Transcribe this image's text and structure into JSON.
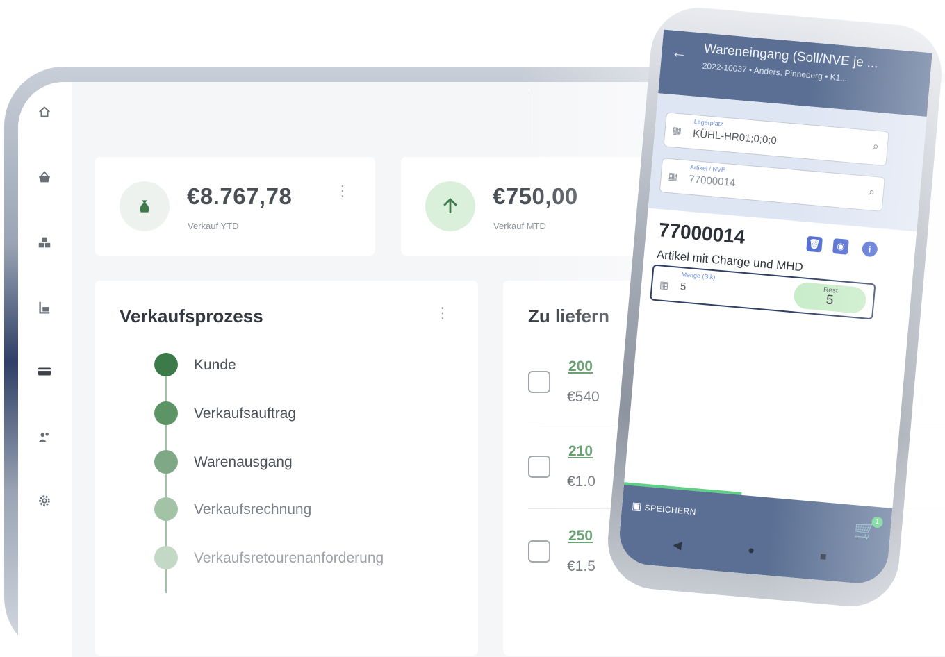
{
  "sidebar": {
    "items": [
      {
        "icon": "home-icon"
      },
      {
        "icon": "basket-icon"
      },
      {
        "icon": "boxes-icon"
      },
      {
        "icon": "forklift-icon"
      },
      {
        "icon": "card-icon"
      },
      {
        "icon": "people-icon"
      },
      {
        "icon": "gear-icon"
      }
    ]
  },
  "kpis": [
    {
      "value": "€8.767,78",
      "label": "Verkauf YTD",
      "icon": "money-bag-icon"
    },
    {
      "value": "€750,00",
      "label": "Verkauf MTD",
      "icon": "arrow-up-icon"
    }
  ],
  "process": {
    "title": "Verkaufsprozess",
    "steps": [
      {
        "label": "Kunde"
      },
      {
        "label": "Verkaufsauftrag"
      },
      {
        "label": "Warenausgang"
      },
      {
        "label": "Verkaufsrechnung"
      },
      {
        "label": "Verkaufsretourenanforderung"
      }
    ]
  },
  "deliveries": {
    "title": "Zu liefern",
    "rows": [
      {
        "order": "200",
        "amount": "€540"
      },
      {
        "order": "210",
        "amount": "€1.0"
      },
      {
        "order": "250",
        "amount": "€1.5"
      }
    ]
  },
  "phone": {
    "title": "Wareneingang (Soll/NVE je ...",
    "subtitle": "2022-10037 • Anders, Pinneberg • K1...",
    "lagerplatz_label": "Lagerplatz",
    "lagerplatz_value": "KÜHL-HR01;0;0;0",
    "artikel_label": "Artikel / NVE",
    "artikel_value": "77000014",
    "article_number": "77000014",
    "article_description": "Artikel mit Charge und MHD",
    "menge_label": "Menge (Stk)",
    "menge_value": "5",
    "rest_label": "Rest",
    "rest_value": "5",
    "save_label": "SPEICHERN",
    "cart_count": "1"
  },
  "colors": {
    "accent_green": "#4c8e58",
    "navy": "#2f3f66",
    "phone_bar": "#5a6f93"
  }
}
